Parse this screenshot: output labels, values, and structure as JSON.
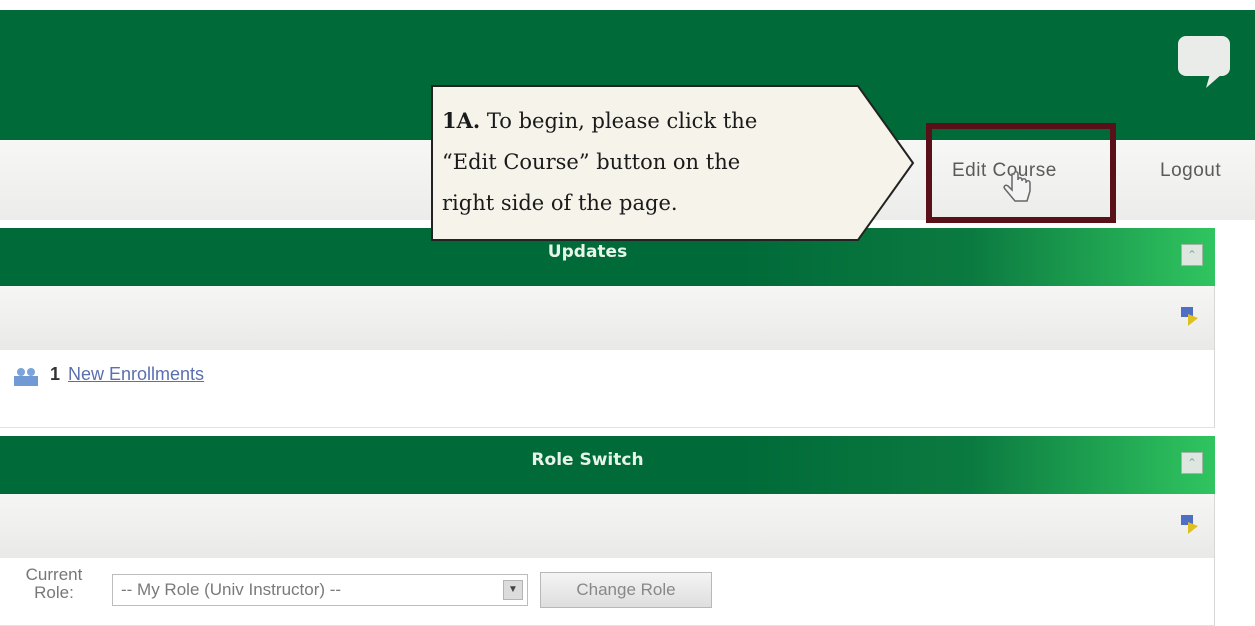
{
  "nav": {
    "edit_course": "Edit Course",
    "logout": "Logout"
  },
  "callout": {
    "step": "1A.",
    "line1": "To begin, please click the",
    "line2": "“Edit Course” button on the",
    "line3": "right side of the page."
  },
  "updates": {
    "title": "Updates",
    "collapse_symbol": "⌃",
    "enrollments_count": "1",
    "enrollments_link": "New Enrollments"
  },
  "role_switch": {
    "title": "Role Switch",
    "collapse_symbol": "⌃",
    "current_role_label_line1": "Current",
    "current_role_label_line2": "Role:",
    "selected_role": "-- My Role (Univ Instructor) --",
    "change_role_button": "Change Role"
  },
  "icons": {
    "chat": "chat-bubble-icon",
    "cursor": "hand-cursor-icon",
    "tool": "settings-wizard-icon",
    "enrollments": "users-icon"
  },
  "colors": {
    "brand_green": "#006a38",
    "highlight_border": "#5a1018",
    "link_blue": "#5b6fb0",
    "callout_bg": "#f5f3ea"
  }
}
